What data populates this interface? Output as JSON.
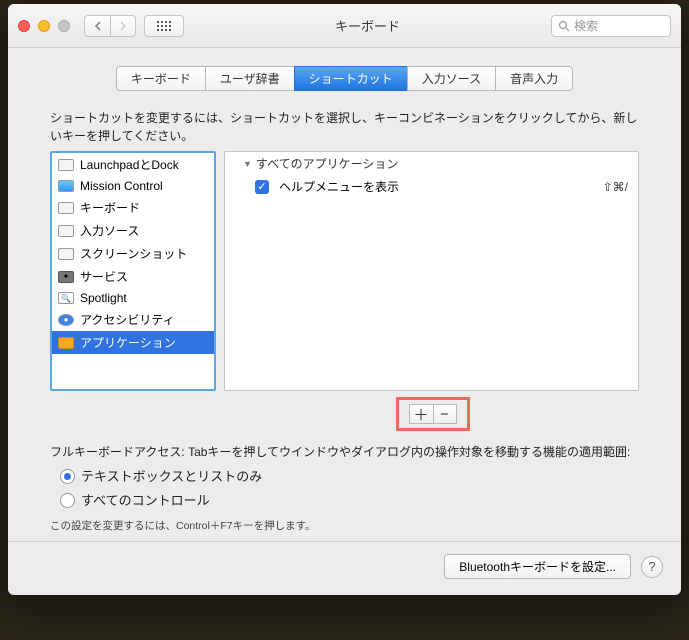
{
  "window": {
    "title": "キーボード"
  },
  "search": {
    "placeholder": "検索"
  },
  "tabs": {
    "keyboard": "キーボード",
    "userdict": "ユーザ辞書",
    "shortcuts": "ショートカット",
    "input": "入力ソース",
    "voice": "音声入力"
  },
  "instruction": "ショートカットを変更するには、ショートカットを選択し、キーコンビネーションをクリックしてから、新しいキーを押してください。",
  "categories": [
    "LaunchpadとDock",
    "Mission Control",
    "キーボード",
    "入力ソース",
    "スクリーンショット",
    "サービス",
    "Spotlight",
    "アクセシビリティ",
    "アプリケーション"
  ],
  "group": {
    "header": "すべてのアプリケーション",
    "items": [
      {
        "checked": true,
        "label": "ヘルプメニューを表示",
        "shortcut": "⇧⌘/"
      }
    ]
  },
  "fk": {
    "label": "フルキーボードアクセス: Tabキーを押してウインドウやダイアログ内の操作対象を移動する機能の適用範囲:",
    "opt1": "テキストボックスとリストのみ",
    "opt2": "すべてのコントロール",
    "hint": "この設定を変更するには、Control＋F7キーを押します。"
  },
  "bluetooth_btn": "Bluetoothキーボードを設定..."
}
